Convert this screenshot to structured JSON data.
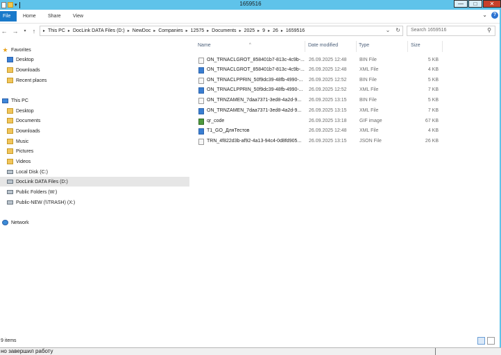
{
  "window": {
    "title": "1659516",
    "controls": {
      "minimize": "—",
      "maximize": "□",
      "close": "✕"
    }
  },
  "ribbon": {
    "tabs": [
      "File",
      "Home",
      "Share",
      "View"
    ],
    "expand_glyph": "⌄",
    "help_glyph": "?"
  },
  "nav": {
    "back": "←",
    "forward": "→",
    "recent": "▾",
    "up": "↑",
    "breadcrumb": [
      "This PC",
      "DocLink DATA Files (D:)",
      "NewDoc",
      "Companies",
      "12575",
      "Documents",
      "2025",
      "9",
      "26",
      "1659516"
    ],
    "refresh": "↻",
    "search_placeholder": "Search 1659516"
  },
  "navpane": {
    "items": [
      {
        "label": "Favorites",
        "icon": "star-icon",
        "level": 0
      },
      {
        "label": "Desktop",
        "icon": "folder-blue-icon",
        "level": 1
      },
      {
        "label": "Downloads",
        "icon": "folder-icon",
        "level": 1
      },
      {
        "label": "Recent places",
        "icon": "recent-places-icon",
        "level": 1
      },
      {
        "label": "This PC",
        "icon": "computer-icon",
        "level": 0
      },
      {
        "label": "Desktop",
        "icon": "folder-icon",
        "level": 1
      },
      {
        "label": "Documents",
        "icon": "folder-icon",
        "level": 1
      },
      {
        "label": "Downloads",
        "icon": "folder-icon",
        "level": 1
      },
      {
        "label": "Music",
        "icon": "music-folder-icon",
        "level": 1
      },
      {
        "label": "Pictures",
        "icon": "folder-icon",
        "level": 1
      },
      {
        "label": "Videos",
        "icon": "folder-icon",
        "level": 1
      },
      {
        "label": "Local Disk (C:)",
        "icon": "disk-icon",
        "level": 1
      },
      {
        "label": "DocLink DATA Files (D:)",
        "icon": "disk-icon",
        "level": 1,
        "selected": true
      },
      {
        "label": "Public Folders (W:)",
        "icon": "network-drive-icon",
        "level": 1
      },
      {
        "label": "Public-NEW (\\\\TRASH) (X:)",
        "icon": "network-drive-icon",
        "level": 1
      },
      {
        "label": "Network",
        "icon": "network-icon",
        "level": 0
      }
    ]
  },
  "content": {
    "columns": [
      "Name",
      "Date modified",
      "Type",
      "Size"
    ],
    "files": [
      {
        "name": "ON_TRNACLGROT_858401b7-813c-4c9b-...",
        "date": "26.09.2025 12:48",
        "type": "BIN File",
        "size": "5 KB",
        "icon": "bin-file-icon"
      },
      {
        "name": "ON_TRNACLGROT_858401b7-813c-4c9b-...",
        "date": "26.09.2025 12:48",
        "type": "XML File",
        "size": "4 KB",
        "icon": "xml-file-icon"
      },
      {
        "name": "ON_TRNACLPPRIN_50f9dc39-48fb-4990-...",
        "date": "26.09.2025 12:52",
        "type": "BIN File",
        "size": "5 KB",
        "icon": "bin-file-icon"
      },
      {
        "name": "ON_TRNACLPPRIN_50f9dc39-48fb-4990-...",
        "date": "26.09.2025 12:52",
        "type": "XML File",
        "size": "7 KB",
        "icon": "xml-file-icon"
      },
      {
        "name": "ON_TRNZAMEN_7daa7371-3ed8-4a2d-9...",
        "date": "26.09.2025 13:15",
        "type": "BIN File",
        "size": "5 KB",
        "icon": "bin-file-icon"
      },
      {
        "name": "ON_TRNZAMEN_7daa7371-3ed8-4a2d-9...",
        "date": "26.09.2025 13:15",
        "type": "XML File",
        "size": "7 KB",
        "icon": "xml-file-icon"
      },
      {
        "name": "qr_code",
        "date": "26.09.2025 13:18",
        "type": "GIF image",
        "size": "67 KB",
        "icon": "gif-image-icon"
      },
      {
        "name": "T1_GO_ДляТестов",
        "date": "26.09.2025 12:48",
        "type": "XML File",
        "size": "4 KB",
        "icon": "xml-file-icon"
      },
      {
        "name": "TRN_4f822d3b-af92-4a13-94c4-0d8fd905...",
        "date": "26.09.2025 13:15",
        "type": "JSON File",
        "size": "26 KB",
        "icon": "json-file-icon"
      }
    ]
  },
  "status": {
    "item_count": "9 items"
  },
  "taskbar_peek": {
    "text": "но завершил работу"
  },
  "colors": {
    "titlebar": "#5fc3ea",
    "file_tab": "#1979ca",
    "selection": "#e6e6e6"
  }
}
